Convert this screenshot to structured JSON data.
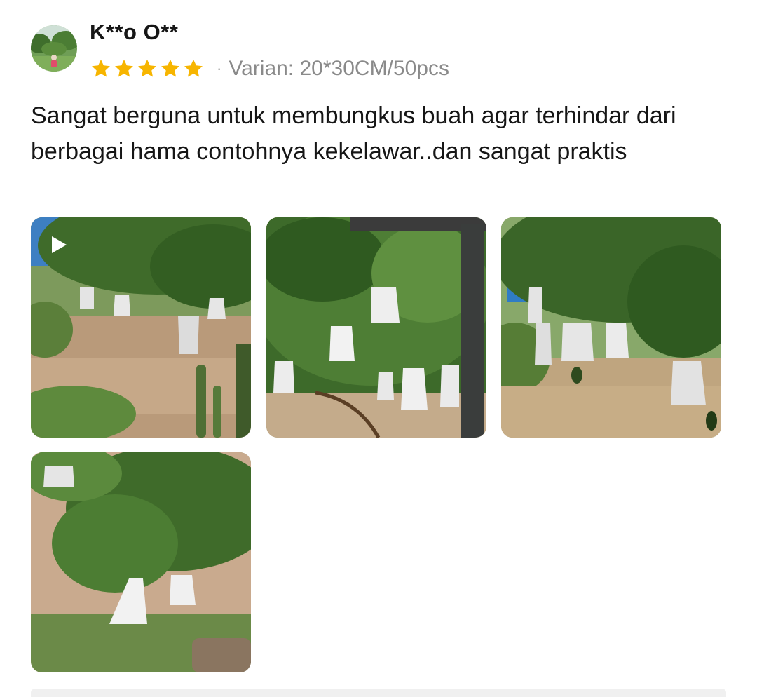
{
  "review": {
    "username": "K**o O**",
    "rating": 5,
    "rating_max": 5,
    "variant_label": "Varian: 20*30CM/50pcs",
    "separator": "·",
    "text": "Sangat berguna untuk membungkus buah agar terhindar dari berbagai hama contohnya kekelawar..dan sangat praktis",
    "star_color": "#f7b500",
    "photos": [
      {
        "kind": "video",
        "icon": "play-icon"
      },
      {
        "kind": "image"
      },
      {
        "kind": "image"
      },
      {
        "kind": "image"
      }
    ]
  }
}
